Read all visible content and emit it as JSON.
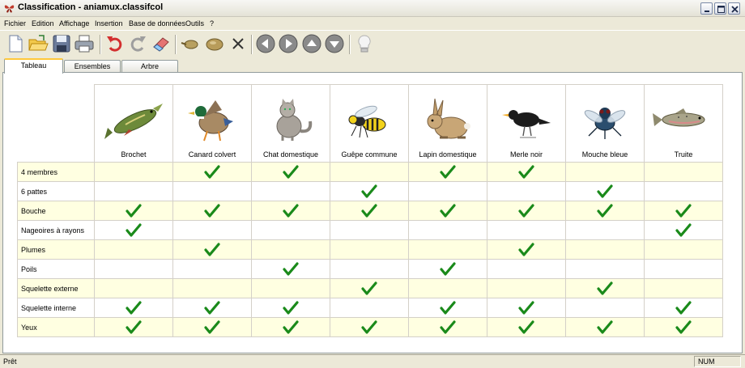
{
  "window": {
    "title": "Classification - aniamux.classifcol",
    "icon": "butterfly-app-icon",
    "controls": [
      "minimize-icon",
      "maximize-icon",
      "close-icon"
    ]
  },
  "menu": {
    "items": [
      "Fichier",
      "Edition",
      "Affichage",
      "Insertion",
      "Base de données",
      "Outils",
      "?"
    ]
  },
  "toolbar": {
    "buttons": [
      "new-document-icon",
      "open-folder-icon",
      "save-icon",
      "print-icon",
      "undo-icon",
      "redo-icon",
      "eraser-icon",
      "add-element-icon",
      "add-group-icon",
      "delete-icon",
      "arrow-left-icon",
      "arrow-right-icon",
      "arrow-up-icon",
      "arrow-down-icon",
      "lightbulb-icon"
    ]
  },
  "tabs": [
    {
      "label": "Tableau",
      "active": true
    },
    {
      "label": "Ensembles",
      "active": false
    },
    {
      "label": "Arbre",
      "active": false
    }
  ],
  "table": {
    "animals": [
      {
        "name": "Brochet",
        "icon": "pike-fish-image"
      },
      {
        "name": "Canard colvert",
        "icon": "mallard-duck-image"
      },
      {
        "name": "Chat domestique",
        "icon": "cat-image"
      },
      {
        "name": "Guêpe commune",
        "icon": "wasp-image"
      },
      {
        "name": "Lapin domestique",
        "icon": "rabbit-image"
      },
      {
        "name": "Merle noir",
        "icon": "blackbird-image"
      },
      {
        "name": "Mouche bleue",
        "icon": "blowfly-image"
      },
      {
        "name": "Truite",
        "icon": "trout-image"
      }
    ],
    "rows": [
      {
        "label": "4 membres",
        "checks": [
          false,
          true,
          true,
          false,
          true,
          true,
          false,
          false
        ]
      },
      {
        "label": "6 pattes",
        "checks": [
          false,
          false,
          false,
          true,
          false,
          false,
          true,
          false
        ]
      },
      {
        "label": "Bouche",
        "checks": [
          true,
          true,
          true,
          true,
          true,
          true,
          true,
          true
        ]
      },
      {
        "label": "Nageoires à rayons",
        "checks": [
          true,
          false,
          false,
          false,
          false,
          false,
          false,
          true
        ]
      },
      {
        "label": "Plumes",
        "checks": [
          false,
          true,
          false,
          false,
          false,
          true,
          false,
          false
        ]
      },
      {
        "label": "Poils",
        "checks": [
          false,
          false,
          true,
          false,
          true,
          false,
          false,
          false
        ]
      },
      {
        "label": "Squelette externe",
        "checks": [
          false,
          false,
          false,
          true,
          false,
          false,
          true,
          false
        ]
      },
      {
        "label": "Squelette interne",
        "checks": [
          true,
          true,
          true,
          false,
          true,
          true,
          false,
          true
        ]
      },
      {
        "label": "Yeux",
        "checks": [
          true,
          true,
          true,
          true,
          true,
          true,
          true,
          true
        ]
      }
    ],
    "colors": {
      "check": "#1a8a1a",
      "row_highlight": "#ffffe1"
    }
  },
  "status": {
    "text": "Prêt",
    "num": "NUM"
  }
}
